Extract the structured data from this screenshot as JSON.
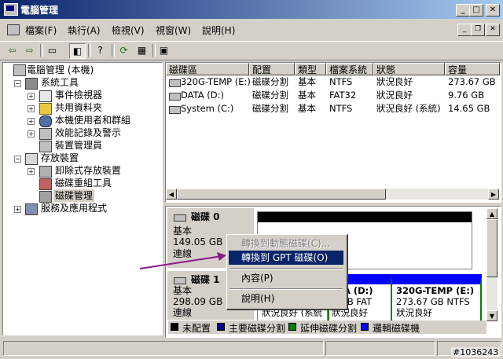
{
  "window": {
    "title": "電腦管理"
  },
  "menu": [
    "檔案(F)",
    "執行(A)",
    "檢視(V)",
    "視窗(W)",
    "說明(H)"
  ],
  "tree": {
    "root": "電腦管理 (本機)",
    "system_tools": "系統工具",
    "event_viewer": "事件檢視器",
    "shared_folders": "共用資料夾",
    "local_users": "本機使用者和群組",
    "perf_logs": "效能記錄及警示",
    "device_manager": "裝置管理員",
    "storage": "存放裝置",
    "removable": "卸除式存放裝置",
    "defrag": "磁碟重組工具",
    "disk_mgmt": "磁碟管理",
    "services": "服務及應用程式"
  },
  "list": {
    "headers": [
      "磁碟區",
      "配置",
      "類型",
      "檔案系統",
      "狀態",
      "容量"
    ],
    "rows": [
      [
        "320G-TEMP (E:)",
        "磁碟分割",
        "基本",
        "NTFS",
        "狀況良好",
        "273.67 GB"
      ],
      [
        "DATA (D:)",
        "磁碟分割",
        "基本",
        "FAT32",
        "狀況良好",
        "9.76 GB"
      ],
      [
        "System (C:)",
        "磁碟分割",
        "基本",
        "NTFS",
        "狀況良好 (系統)",
        "14.65 GB"
      ]
    ]
  },
  "disks": {
    "disk0": {
      "name": "磁碟 0",
      "type": "基本",
      "size": "149.05 GB",
      "status": "連線"
    },
    "disk1": {
      "name": "磁碟 1",
      "type": "基本",
      "size": "298.09 GB",
      "status": "連線"
    },
    "disk1_vols": {
      "v1_status": "狀況良好 (系統",
      "v2_name": "ATA  (D:)",
      "v2_size": "7 GB FAT",
      "v2_status": "狀況良好",
      "v3_name": "320G-TEMP  (E:)",
      "v3_size": "273.67 GB NTFS",
      "v3_status": "狀況良好"
    }
  },
  "legend": [
    "未配置",
    "主要磁碟分割",
    "延伸磁碟分割",
    "邏輯磁碟機"
  ],
  "legend_colors": [
    "#000000",
    "#000080",
    "#008000",
    "#0000ff"
  ],
  "context_menu": {
    "convert_dynamic": "轉換到動態磁碟(C)...",
    "convert_gpt": "轉換到 GPT 磁碟(O)",
    "properties": "內容(P)",
    "help": "說明(H)"
  },
  "watermark": "#1036243"
}
